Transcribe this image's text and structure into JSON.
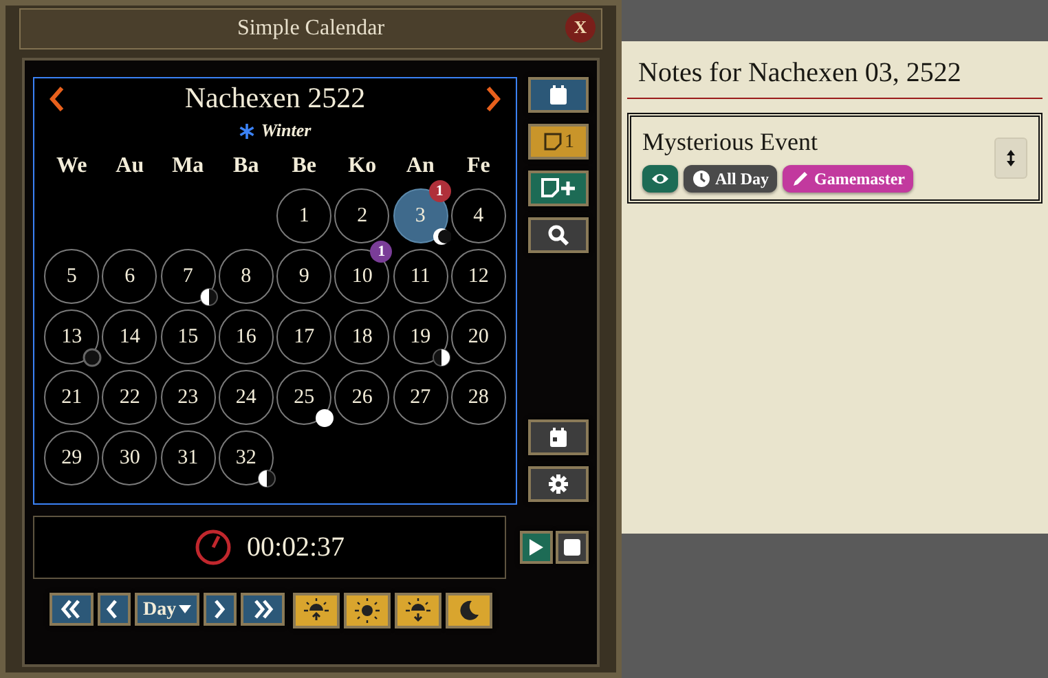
{
  "window": {
    "title": "Simple Calendar",
    "close_label": "X"
  },
  "calendar": {
    "month_title": "Nachexen 2522",
    "season": "Winter",
    "weekdays": [
      "We",
      "Au",
      "Ma",
      "Ba",
      "Be",
      "Ko",
      "An",
      "Fe"
    ],
    "weeks": [
      [
        {
          "kind": "blank"
        },
        {
          "kind": "blank"
        },
        {
          "kind": "blank"
        },
        {
          "kind": "blank"
        },
        {
          "day": "1",
          "selected": false
        },
        {
          "day": "2",
          "selected": false
        },
        {
          "day": "3",
          "selected": true,
          "moon": {
            "kind": "waning-crescent"
          },
          "badge": {
            "count": "1",
            "color": "#b0303a"
          }
        },
        {
          "day": "4",
          "selected": false
        }
      ],
      [
        {
          "day": "5",
          "selected": false
        },
        {
          "day": "6",
          "selected": false
        },
        {
          "day": "7",
          "selected": false,
          "moon": {
            "kind": "last-quarter"
          }
        },
        {
          "day": "8",
          "selected": false
        },
        {
          "day": "9",
          "selected": false
        },
        {
          "day": "10",
          "selected": false,
          "badge": {
            "count": "1",
            "color": "#7a3d98"
          }
        },
        {
          "day": "11",
          "selected": false
        },
        {
          "day": "12",
          "selected": false
        }
      ],
      [
        {
          "day": "13",
          "selected": false,
          "moon": {
            "kind": "new"
          }
        },
        {
          "day": "14",
          "selected": false
        },
        {
          "day": "15",
          "selected": false
        },
        {
          "day": "16",
          "selected": false
        },
        {
          "day": "17",
          "selected": false
        },
        {
          "day": "18",
          "selected": false
        },
        {
          "day": "19",
          "selected": false,
          "moon": {
            "kind": "first-quarter"
          }
        },
        {
          "day": "20",
          "selected": false
        }
      ],
      [
        {
          "day": "21",
          "selected": false
        },
        {
          "day": "22",
          "selected": false
        },
        {
          "day": "23",
          "selected": false
        },
        {
          "day": "24",
          "selected": false
        },
        {
          "day": "25",
          "selected": false,
          "moon": {
            "kind": "full"
          }
        },
        {
          "day": "26",
          "selected": false
        },
        {
          "day": "27",
          "selected": false
        },
        {
          "day": "28",
          "selected": false
        }
      ],
      [
        {
          "day": "29",
          "selected": false
        },
        {
          "day": "30",
          "selected": false
        },
        {
          "day": "31",
          "selected": false
        },
        {
          "day": "32",
          "selected": false,
          "moon": {
            "kind": "last-quarter"
          }
        }
      ]
    ]
  },
  "side_buttons": [
    {
      "kind": "today"
    },
    {
      "kind": "notes",
      "count": "1"
    },
    {
      "kind": "add-note"
    },
    {
      "kind": "search"
    }
  ],
  "side_buttons_lower": [
    {
      "kind": "date-config"
    },
    {
      "kind": "settings"
    }
  ],
  "clock": {
    "time": "00:02:37"
  },
  "clock_controls": [
    {
      "kind": "play"
    },
    {
      "kind": "stop"
    }
  ],
  "time_controls": [
    {
      "kind": "back-far"
    },
    {
      "kind": "back"
    },
    {
      "kind": "unit",
      "label": "Day"
    },
    {
      "kind": "forward"
    },
    {
      "kind": "forward-far"
    }
  ],
  "time_of_day": [
    {
      "kind": "sunrise"
    },
    {
      "kind": "midday"
    },
    {
      "kind": "sunset"
    },
    {
      "kind": "midnight"
    }
  ],
  "notes": {
    "title": "Notes for Nachexen 03, 2522",
    "items": [
      {
        "title": "Mysterious Event",
        "tags": [
          {
            "kind": "visibility",
            "color": "#1d6b55"
          },
          {
            "kind": "time",
            "label": "All Day",
            "color": "#4a4a4a"
          },
          {
            "kind": "author",
            "label": "Gamemaster",
            "color": "#c2399e"
          }
        ]
      }
    ]
  }
}
